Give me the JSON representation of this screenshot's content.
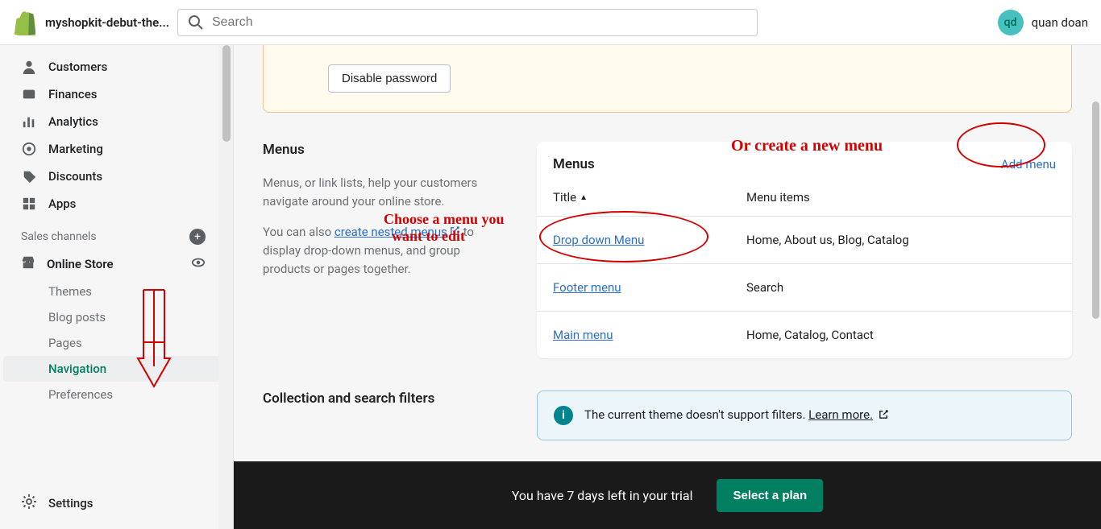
{
  "topbar": {
    "store_name": "myshopkit-debut-the...",
    "search_placeholder": "Search",
    "avatar_initials": "qd",
    "username": "quan doan"
  },
  "sidebar": {
    "items": [
      {
        "label": "Customers"
      },
      {
        "label": "Finances"
      },
      {
        "label": "Analytics"
      },
      {
        "label": "Marketing"
      },
      {
        "label": "Discounts"
      },
      {
        "label": "Apps"
      }
    ],
    "section_label": "Sales channels",
    "channel": "Online Store",
    "sub_items": [
      {
        "label": "Themes"
      },
      {
        "label": "Blog posts"
      },
      {
        "label": "Pages"
      },
      {
        "label": "Navigation"
      },
      {
        "label": "Preferences"
      }
    ],
    "settings": "Settings"
  },
  "banner": {
    "disable_btn": "Disable password"
  },
  "menus": {
    "left_title": "Menus",
    "desc1": "Menus, or link lists, help your customers navigate around your online store.",
    "desc2_a": "You can also ",
    "desc2_link": "create nested menus",
    "desc2_b": " to display drop-down menus, and group products or pages together.",
    "card_title": "Menus",
    "add_link": "Add menu",
    "col_title": "Title",
    "col_items": "Menu items",
    "rows": [
      {
        "title": "Drop down Menu",
        "items": "Home, About us, Blog, Catalog"
      },
      {
        "title": "Footer menu",
        "items": "Search"
      },
      {
        "title": "Main menu",
        "items": "Home, Catalog, Contact"
      }
    ]
  },
  "filters": {
    "left_title": "Collection and search filters",
    "info_a": "The current theme doesn't support filters. ",
    "info_link": "Learn more."
  },
  "trial": {
    "text": "You have 7 days left in your trial",
    "btn": "Select a plan"
  },
  "annotations": {
    "choose1": "Choose a menu you",
    "choose2": "want to edit",
    "create": "Or create a new menu"
  }
}
